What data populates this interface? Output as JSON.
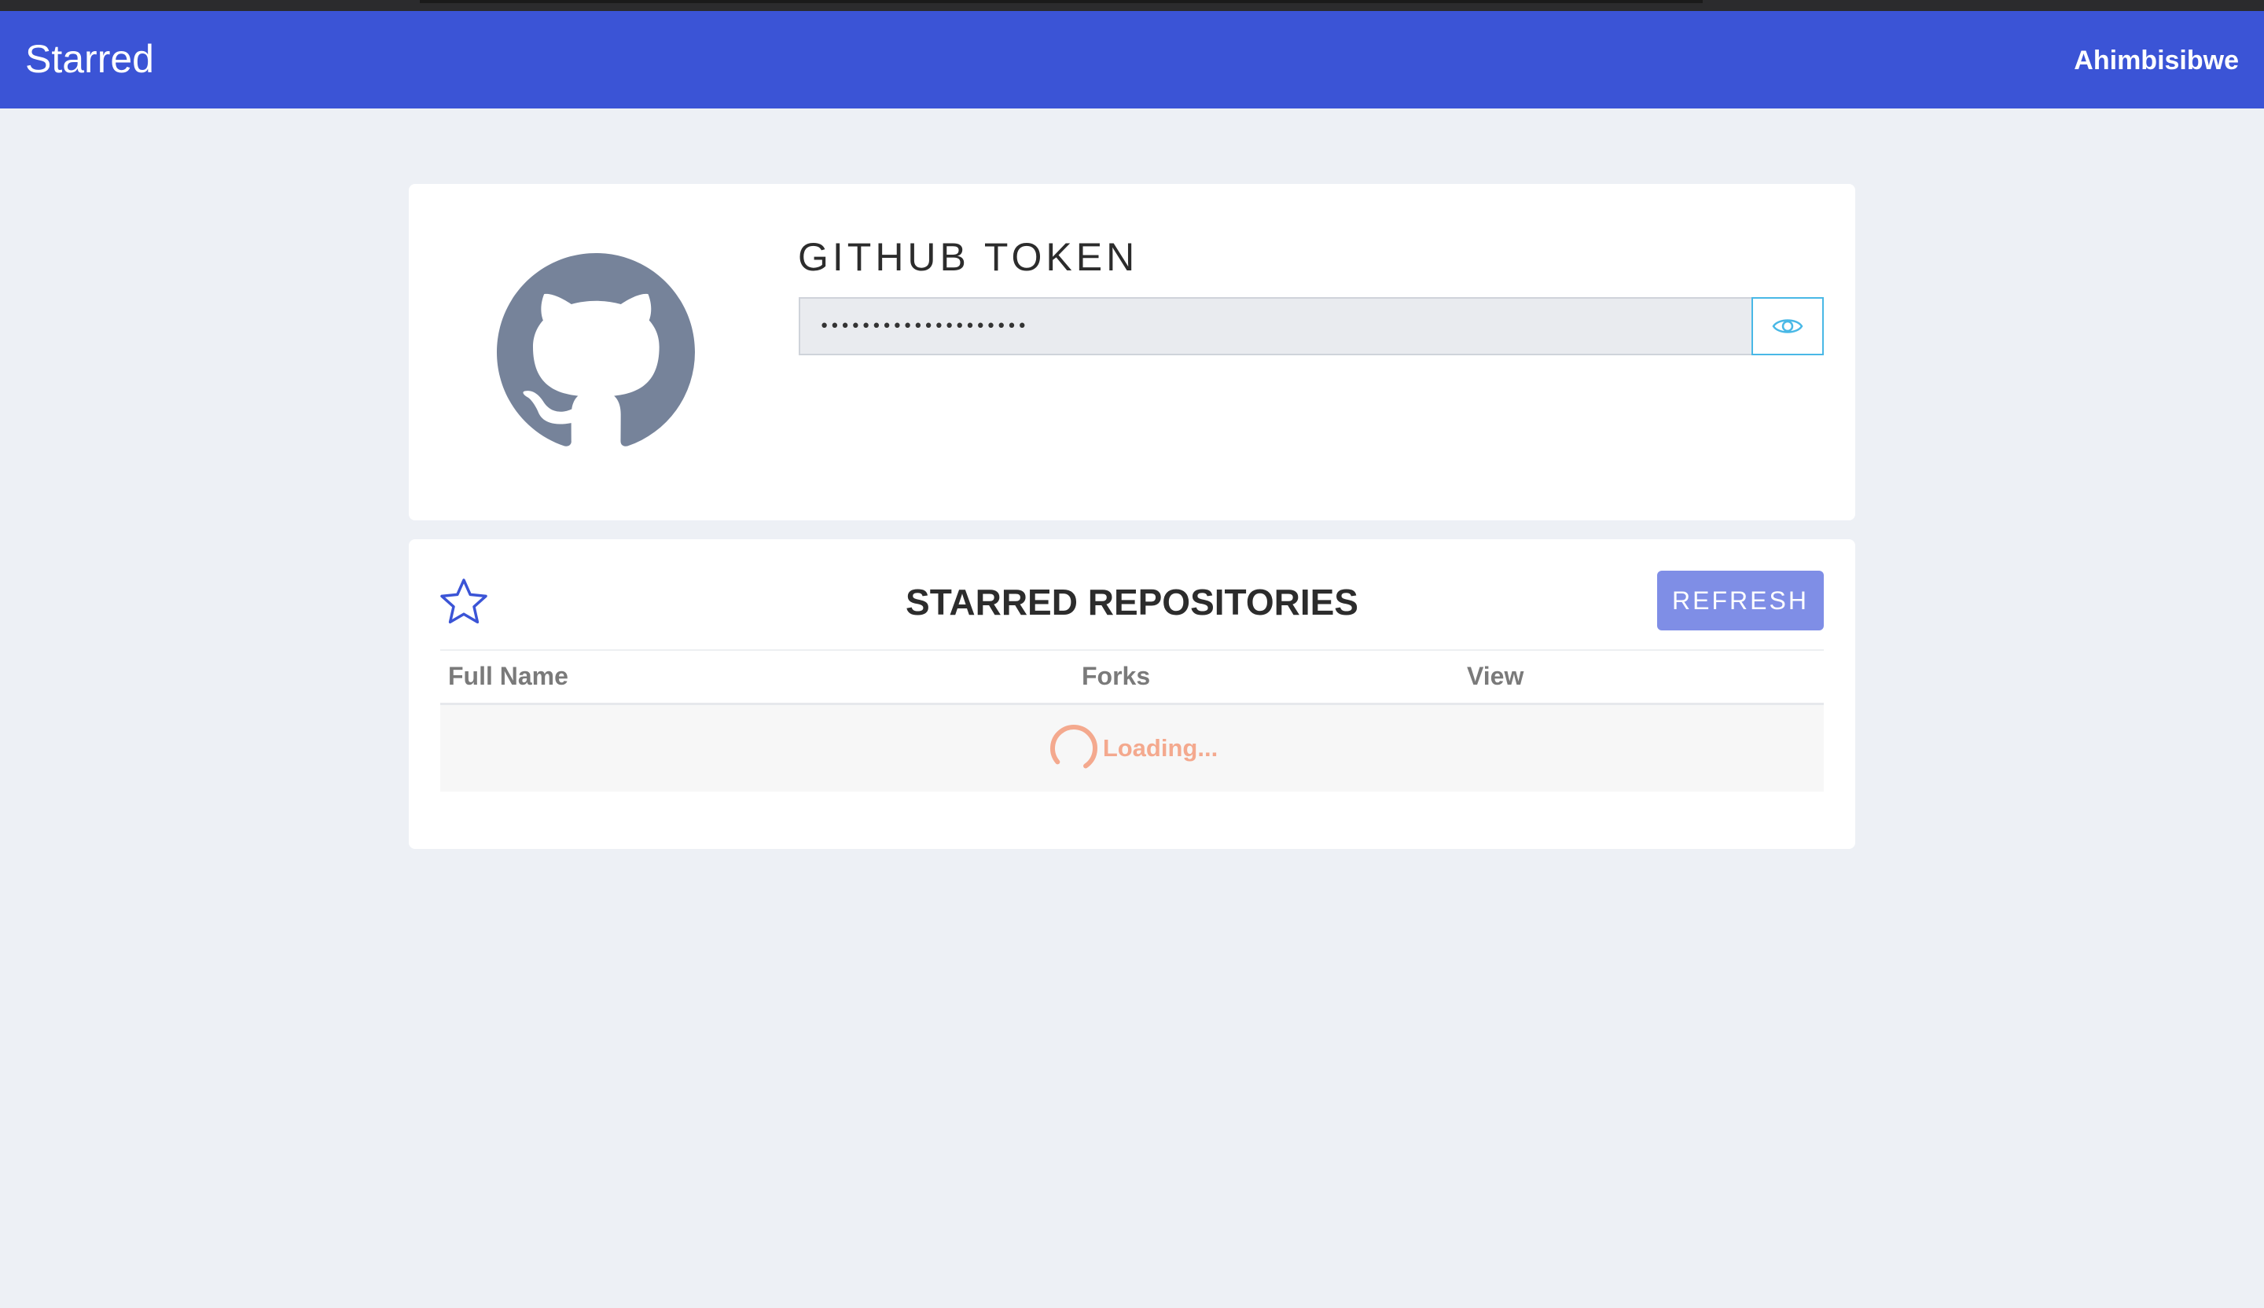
{
  "navbar": {
    "brand": "Starred",
    "user": "Ahimbisibwe"
  },
  "token_card": {
    "title": "GITHUB TOKEN",
    "token_value": "********************",
    "avatar_icon": "github-octocat-icon",
    "toggle_icon": "eye-icon"
  },
  "repos_card": {
    "star_icon": "star-icon",
    "title": "STARRED REPOSITORIES",
    "refresh_label": "REFRESH",
    "columns": [
      "Full Name",
      "Forks",
      "View"
    ],
    "loading_text": "Loading..."
  },
  "colors": {
    "navbar": "#3b54d6",
    "refresh_button": "#7f8ee6",
    "eye_accent": "#49b8e6",
    "loading": "#f4a98e",
    "avatar": "#76839a"
  }
}
